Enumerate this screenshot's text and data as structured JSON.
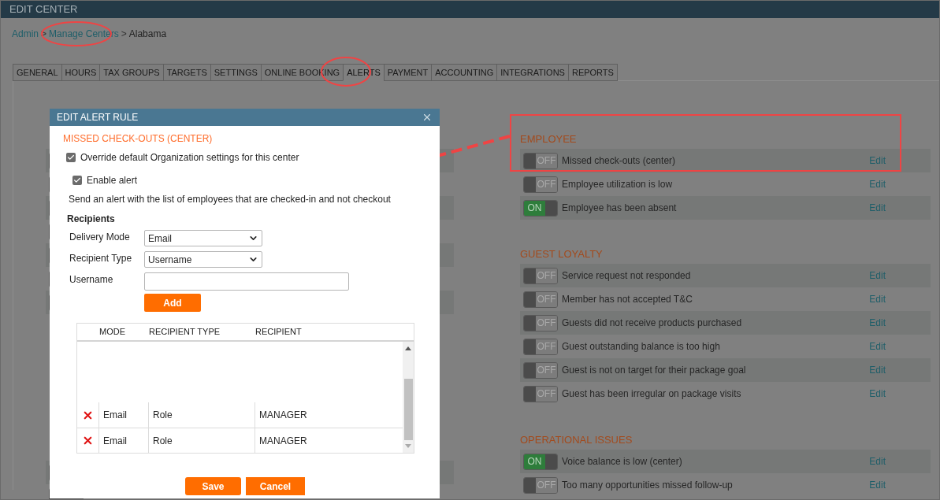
{
  "window": {
    "title": "EDIT CENTER"
  },
  "breadcrumb": [
    {
      "label": "Admin",
      "kind": "link"
    },
    {
      "label": ">",
      "kind": "separator"
    },
    {
      "label": "Manage Centers",
      "kind": "link"
    },
    {
      "label": ">",
      "kind": "separator"
    },
    {
      "label": "Alabama",
      "kind": "current"
    }
  ],
  "tabs": [
    {
      "label": "GENERAL",
      "selected": false
    },
    {
      "label": "HOURS",
      "selected": false
    },
    {
      "label": "TAX GROUPS",
      "selected": false
    },
    {
      "label": "TARGETS",
      "selected": false
    },
    {
      "label": "SETTINGS",
      "selected": false
    },
    {
      "label": "ONLINE BOOKING",
      "selected": false
    },
    {
      "label": "ALERTS",
      "selected": true
    },
    {
      "label": "PAYMENT",
      "selected": false
    },
    {
      "label": "ACCOUNTING",
      "selected": false
    },
    {
      "label": "INTEGRATIONS",
      "selected": false
    },
    {
      "label": "REPORTS",
      "selected": false
    }
  ],
  "sections": [
    {
      "heading": "EMPLOYEE",
      "rows": [
        {
          "label": "Missed check-outs (center)",
          "on": false,
          "toggle_text": "OFF",
          "action": "Edit"
        },
        {
          "label": "Employee utilization is low",
          "on": false,
          "toggle_text": "OFF",
          "action": "Edit"
        },
        {
          "label": "Employee has been absent",
          "on": true,
          "toggle_text": "ON",
          "action": "Edit"
        }
      ]
    },
    {
      "heading": "GUEST LOYALTY",
      "rows": [
        {
          "label": "Service request not responded",
          "on": false,
          "toggle_text": "OFF",
          "action": "Edit"
        },
        {
          "label": "Member has not accepted T&C",
          "on": false,
          "toggle_text": "OFF",
          "action": "Edit"
        },
        {
          "label": "Guests did not receive products purchased",
          "on": false,
          "toggle_text": "OFF",
          "action": "Edit"
        },
        {
          "label": "Guest outstanding balance is too high",
          "on": false,
          "toggle_text": "OFF",
          "action": "Edit"
        },
        {
          "label": "Guest is not on target for their package goal",
          "on": false,
          "toggle_text": "OFF",
          "action": "Edit"
        },
        {
          "label": "Guest has been irregular on package visits",
          "on": false,
          "toggle_text": "OFF",
          "action": "Edit"
        }
      ]
    },
    {
      "heading": "OPERATIONAL ISSUES",
      "rows": [
        {
          "label": "Voice balance is low (center)",
          "on": true,
          "toggle_text": "ON",
          "action": "Edit"
        },
        {
          "label": "Too many opportunities missed follow-up",
          "on": false,
          "toggle_text": "OFF",
          "action": "Edit"
        }
      ]
    }
  ],
  "dialog": {
    "title": "EDIT ALERT RULE",
    "rule_name": "MISSED CHECK-OUTS (CENTER)",
    "override": {
      "label": "Override default Organization settings for this center",
      "checked": true
    },
    "enable": {
      "label": "Enable alert",
      "checked": true
    },
    "description": "Send an alert with the list of employees that are checked-in and not checkout",
    "recipients_heading": "Recipients",
    "fields": [
      {
        "label": "Delivery Mode",
        "kind": "select",
        "value": "Email"
      },
      {
        "label": "Recipient Type",
        "kind": "select",
        "value": "Username"
      },
      {
        "label": "Username",
        "kind": "text"
      }
    ],
    "add_button": "Add",
    "table": {
      "columns": [
        "MODE",
        "RECIPIENT TYPE",
        "RECIPIENT"
      ],
      "rows": [
        [
          "Email",
          "Role",
          "MANAGER"
        ],
        [
          "Email",
          "Role",
          "MANAGER"
        ]
      ]
    },
    "buttons": [
      "Save",
      "Cancel"
    ]
  }
}
